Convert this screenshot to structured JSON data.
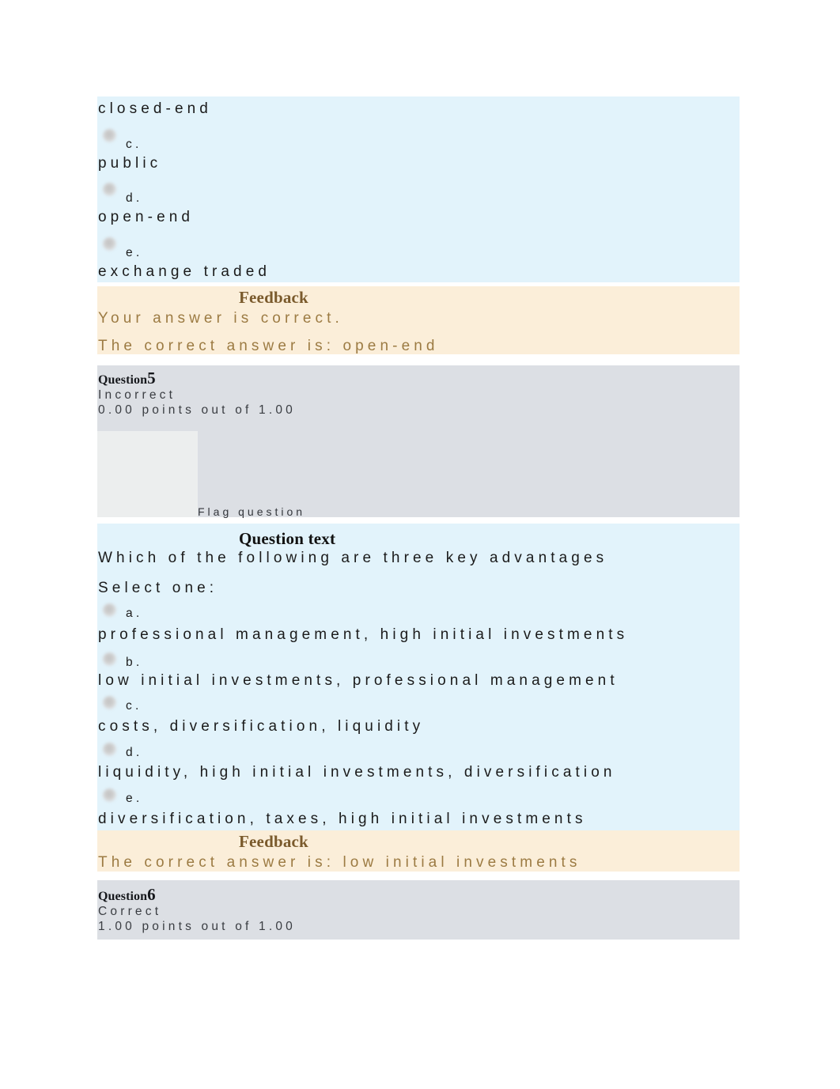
{
  "document": {
    "type": "quiz-review",
    "colors": {
      "option_block_bg": "#e2f3fb",
      "feedback_block_bg": "#fbeed9",
      "question_header_bg": "#dcdfe4",
      "question_header_panel_bg": "#eceeee",
      "feedback_text": "#9c7b43",
      "feedback_heading": "#7a5a2c",
      "body_text": "#1b1b1b",
      "page_bg": "#ffffff"
    }
  },
  "question4_tail": {
    "options": [
      {
        "letter": "",
        "text": "closed-end"
      },
      {
        "letter": "c.",
        "text": "public"
      },
      {
        "letter": "d.",
        "text": "open-end"
      },
      {
        "letter": "e.",
        "text": "exchange traded"
      }
    ],
    "feedback": {
      "heading": "Feedback",
      "line1": "Your answer is correct.",
      "line2": "The correct answer is: open-end"
    }
  },
  "question5": {
    "header": {
      "label": "Question",
      "number": "5",
      "status": "Incorrect",
      "points": "0.00 points out of 1.00",
      "flag_label": "Flag question"
    },
    "question_text_heading": "Question text",
    "question_text": "Which of the following are three key advantages",
    "select_prompt": "Select one:",
    "options": [
      {
        "letter": "a.",
        "text": "professional management, high initial investments"
      },
      {
        "letter": "b.",
        "text": "low initial investments, professional management"
      },
      {
        "letter": "c.",
        "text": "costs, diversification, liquidity"
      },
      {
        "letter": "d.",
        "text": "liquidity, high initial investments, diversification"
      },
      {
        "letter": "e.",
        "text": "diversification, taxes, high initial investments"
      }
    ],
    "feedback": {
      "heading": "Feedback",
      "line1": "The correct answer is: low initial investments"
    }
  },
  "question6": {
    "header": {
      "label": "Question",
      "number": "6",
      "status": "Correct",
      "points": "1.00 points out of 1.00"
    }
  }
}
